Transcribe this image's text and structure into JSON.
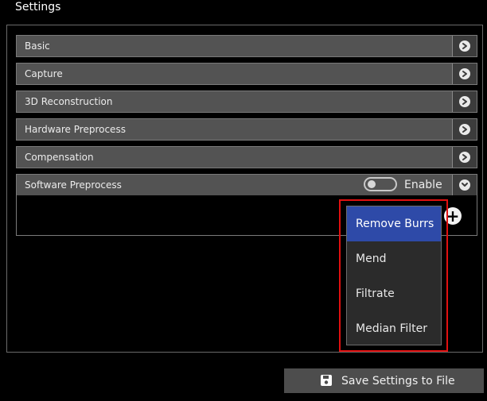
{
  "window": {
    "title": "Settings"
  },
  "sections": [
    {
      "label": "Basic",
      "expanded": false
    },
    {
      "label": "Capture",
      "expanded": false
    },
    {
      "label": "3D Reconstruction",
      "expanded": false
    },
    {
      "label": "Hardware Preprocess",
      "expanded": false
    },
    {
      "label": "Compensation",
      "expanded": false
    },
    {
      "label": "Software Preprocess",
      "expanded": true
    }
  ],
  "software_preprocess": {
    "toggle_label": "Enable",
    "toggle_on": false,
    "add_icon": "plus-icon"
  },
  "dropdown": {
    "items": [
      "Remove Burrs",
      "Mend",
      "Filtrate",
      "Median Filter"
    ],
    "selected_index": 0
  },
  "footer": {
    "save_label": "Save Settings to File",
    "save_icon": "floppy-disk-icon"
  },
  "colors": {
    "accent_selected": "#2e4aa8",
    "highlight_frame": "#e11010",
    "row_bg": "#535353"
  },
  "icons": {
    "collapsed": "chevron-right-icon",
    "expanded": "chevron-down-icon"
  }
}
